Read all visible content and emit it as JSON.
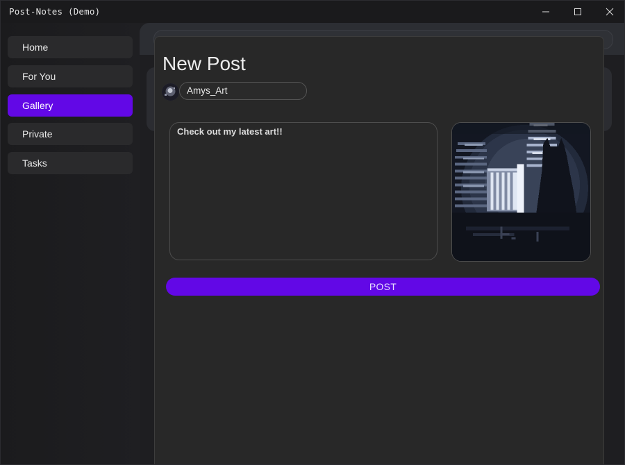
{
  "window": {
    "title": "Post-Notes (Demo)",
    "controls": {
      "minimize_icon": "minimize-icon",
      "maximize_icon": "maximize-icon",
      "close_icon": "close-icon"
    }
  },
  "sidebar": {
    "items": [
      {
        "label": "Home",
        "active": false
      },
      {
        "label": "For You",
        "active": false
      },
      {
        "label": "Gallery",
        "active": true
      },
      {
        "label": "Private",
        "active": false
      },
      {
        "label": "Tasks",
        "active": false
      }
    ]
  },
  "dialog": {
    "title": "New Post",
    "username": "Amys_Art",
    "post_text": "Check out my latest art!!",
    "image_description_icon": "pixel-art-image",
    "post_button_label": "POST"
  },
  "colors": {
    "accent": "#6208e6",
    "window_bg": "#19191b",
    "dialog_bg": "#282828",
    "nav_item_bg": "#2a2a2c"
  }
}
